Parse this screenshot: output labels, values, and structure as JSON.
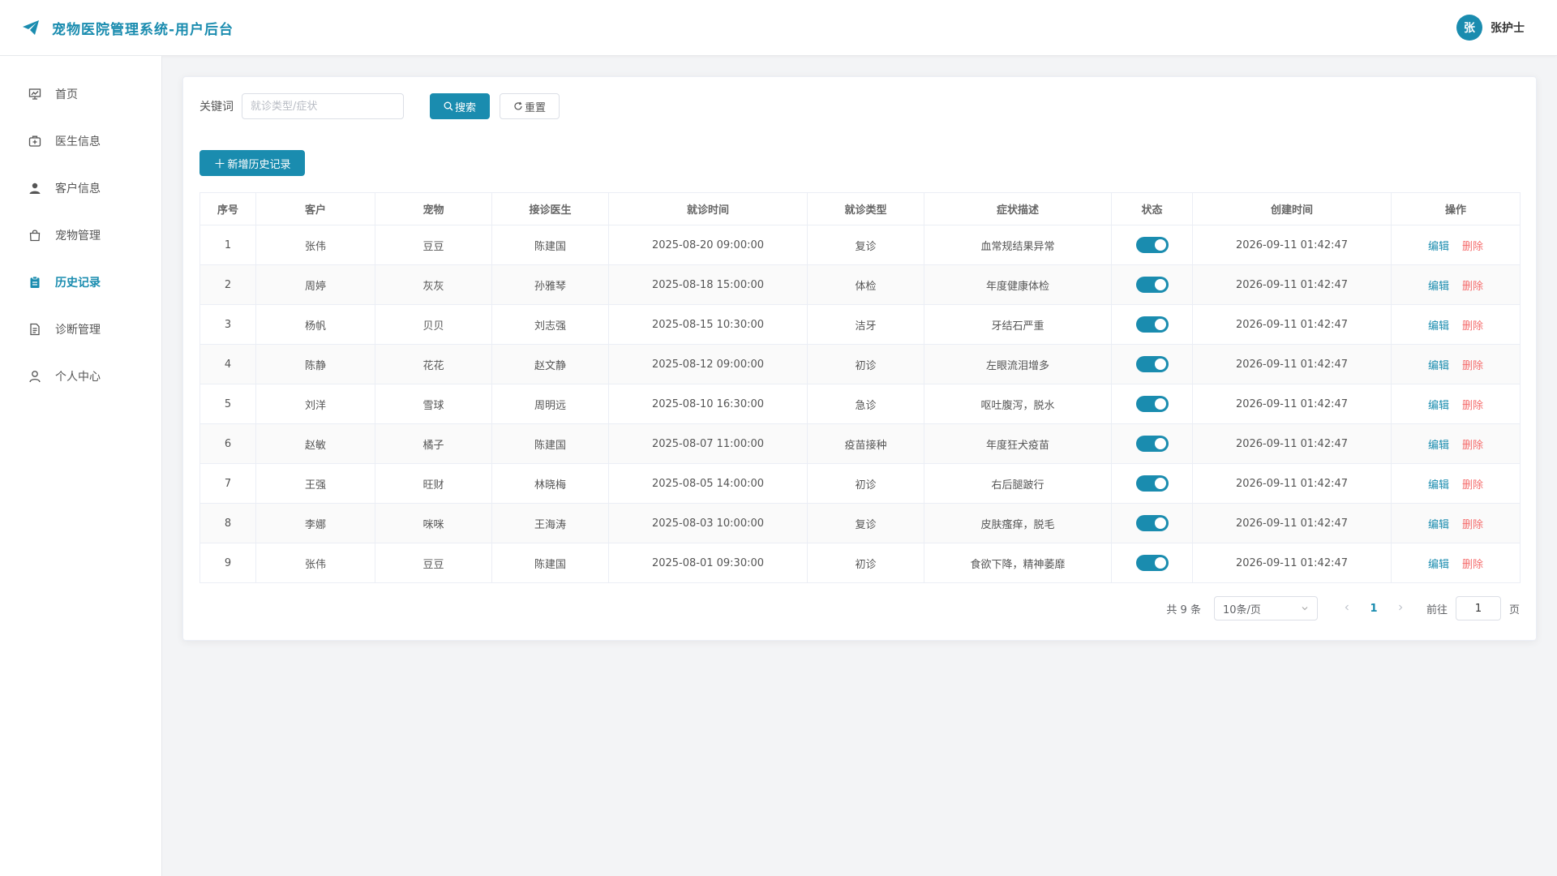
{
  "header": {
    "title": "宠物医院管理系统-用户后台",
    "avatar_text": "张",
    "user_name": "张护士"
  },
  "colors": {
    "primary": "#1a8caf",
    "danger": "#f56c6c"
  },
  "sidebar": {
    "items": [
      {
        "label": "首页",
        "icon": "dashboard-icon"
      },
      {
        "label": "医生信息",
        "icon": "medical-kit-icon"
      },
      {
        "label": "客户信息",
        "icon": "user-icon"
      },
      {
        "label": "宠物管理",
        "icon": "shopping-bag-icon"
      },
      {
        "label": "历史记录",
        "icon": "clipboard-icon",
        "active": true
      },
      {
        "label": "诊断管理",
        "icon": "document-icon"
      },
      {
        "label": "个人中心",
        "icon": "person-outline-icon"
      }
    ]
  },
  "search": {
    "label": "关键词",
    "placeholder": "就诊类型/症状",
    "value": "",
    "search_label": "搜索",
    "reset_label": "重置"
  },
  "toolbar": {
    "add_label": "新增历史记录"
  },
  "table": {
    "headers": [
      "序号",
      "客户",
      "宠物",
      "接诊医生",
      "就诊时间",
      "就诊类型",
      "症状描述",
      "状态",
      "创建时间",
      "操作"
    ],
    "edit_label": "编辑",
    "delete_label": "删除",
    "rows": [
      {
        "no": "1",
        "customer": "张伟",
        "pet": "豆豆",
        "doctor": "陈建国",
        "visit_time": "2025-08-20 09:00:00",
        "type": "复诊",
        "symptom": "血常规结果异常",
        "status": true,
        "created": "2026-09-11 01:42:47"
      },
      {
        "no": "2",
        "customer": "周婷",
        "pet": "灰灰",
        "doctor": "孙雅琴",
        "visit_time": "2025-08-18 15:00:00",
        "type": "体检",
        "symptom": "年度健康体检",
        "status": true,
        "created": "2026-09-11 01:42:47"
      },
      {
        "no": "3",
        "customer": "杨帆",
        "pet": "贝贝",
        "doctor": "刘志强",
        "visit_time": "2025-08-15 10:30:00",
        "type": "洁牙",
        "symptom": "牙结石严重",
        "status": true,
        "created": "2026-09-11 01:42:47"
      },
      {
        "no": "4",
        "customer": "陈静",
        "pet": "花花",
        "doctor": "赵文静",
        "visit_time": "2025-08-12 09:00:00",
        "type": "初诊",
        "symptom": "左眼流泪增多",
        "status": true,
        "created": "2026-09-11 01:42:47"
      },
      {
        "no": "5",
        "customer": "刘洋",
        "pet": "雪球",
        "doctor": "周明远",
        "visit_time": "2025-08-10 16:30:00",
        "type": "急诊",
        "symptom": "呕吐腹泻，脱水",
        "status": true,
        "created": "2026-09-11 01:42:47"
      },
      {
        "no": "6",
        "customer": "赵敏",
        "pet": "橘子",
        "doctor": "陈建国",
        "visit_time": "2025-08-07 11:00:00",
        "type": "疫苗接种",
        "symptom": "年度狂犬疫苗",
        "status": true,
        "created": "2026-09-11 01:42:47"
      },
      {
        "no": "7",
        "customer": "王强",
        "pet": "旺财",
        "doctor": "林晓梅",
        "visit_time": "2025-08-05 14:00:00",
        "type": "初诊",
        "symptom": "右后腿跛行",
        "status": true,
        "created": "2026-09-11 01:42:47"
      },
      {
        "no": "8",
        "customer": "李娜",
        "pet": "咪咪",
        "doctor": "王海涛",
        "visit_time": "2025-08-03 10:00:00",
        "type": "复诊",
        "symptom": "皮肤瘙痒，脱毛",
        "status": true,
        "created": "2026-09-11 01:42:47"
      },
      {
        "no": "9",
        "customer": "张伟",
        "pet": "豆豆",
        "doctor": "陈建国",
        "visit_time": "2025-08-01 09:30:00",
        "type": "初诊",
        "symptom": "食欲下降，精神萎靡",
        "status": true,
        "created": "2026-09-11 01:42:47"
      }
    ]
  },
  "pagination": {
    "total_text": "共 9 条",
    "page_size": "10条/页",
    "current_page": "1",
    "goto_label": "前往",
    "goto_value": "1",
    "page_unit": "页"
  }
}
